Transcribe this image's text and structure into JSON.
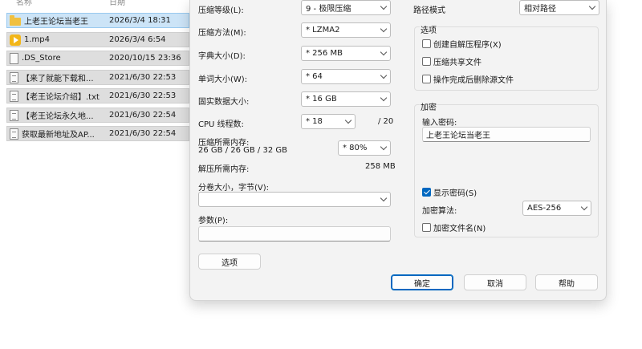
{
  "filelist": {
    "header_name": "名称",
    "header_date": "日期",
    "rows": [
      {
        "icon": "folder-icon",
        "name": "上老王论坛当老王",
        "date": "2026/3/4 18:31",
        "selected": true
      },
      {
        "icon": "media-file-icon",
        "name": "1.mp4",
        "date": "2026/3/4 6:54",
        "selected": false
      },
      {
        "icon": "file-icon",
        "name": ".DS_Store",
        "date": "2020/10/15 23:36",
        "selected": false
      },
      {
        "icon": "text-file-icon",
        "name": "【来了就能下载和...",
        "date": "2021/6/30 22:53",
        "selected": false
      },
      {
        "icon": "text-file-icon",
        "name": "【老王论坛介绍】.txt",
        "date": "2021/6/30 22:53",
        "selected": false
      },
      {
        "icon": "text-file-icon",
        "name": "【老王论坛永久地...",
        "date": "2021/6/30 22:54",
        "selected": false
      },
      {
        "icon": "text-file-icon",
        "name": "获取最新地址及AP...",
        "date": "2021/6/30 22:54",
        "selected": false
      }
    ]
  },
  "dialog": {
    "compression_level_label": "压缩等级(L):",
    "compression_level_value": "9 - 极限压缩",
    "compression_method_label": "压缩方法(M):",
    "compression_method_value": "* LZMA2",
    "dictionary_size_label": "字典大小(D):",
    "dictionary_size_value": "* 256 MB",
    "word_size_label": "单词大小(W):",
    "word_size_value": "* 64",
    "solid_block_label": "固实数据大小:",
    "solid_block_value": "* 16 GB",
    "cpu_threads_label": "CPU 线程数:",
    "cpu_threads_value": "* 18",
    "cpu_threads_max": "/ 20",
    "mem_compress_label": "压缩所需内存:",
    "mem_compress_detail": "26 GB / 26 GB / 32 GB",
    "mem_compress_value": "* 80%",
    "mem_decompress_label": "解压所需内存:",
    "mem_decompress_value": "258 MB",
    "volume_label": "分卷大小，字节(V):",
    "volume_value": "",
    "params_label": "参数(P):",
    "params_value": "",
    "options_button": "选项",
    "path_mode_label": "路径模式",
    "path_mode_value": "相对路径",
    "options_group_title": "选项",
    "opt_sfx": "创建自解压程序(X)",
    "opt_shared": "压缩共享文件",
    "opt_delete": "操作完成后删除源文件",
    "encrypt_group_title": "加密",
    "password_label": "输入密码:",
    "password_value": "上老王论坛当老王",
    "show_password": "显示密码(S)",
    "encrypt_method_label": "加密算法:",
    "encrypt_method_value": "AES-256",
    "encrypt_names": "加密文件名(N)",
    "ok_button": "确定",
    "cancel_button": "取消",
    "help_button": "帮助"
  },
  "colors": {
    "accent": "#0067c0",
    "selection": "#cce4f7",
    "dialog_bg": "#f3f3f3"
  }
}
